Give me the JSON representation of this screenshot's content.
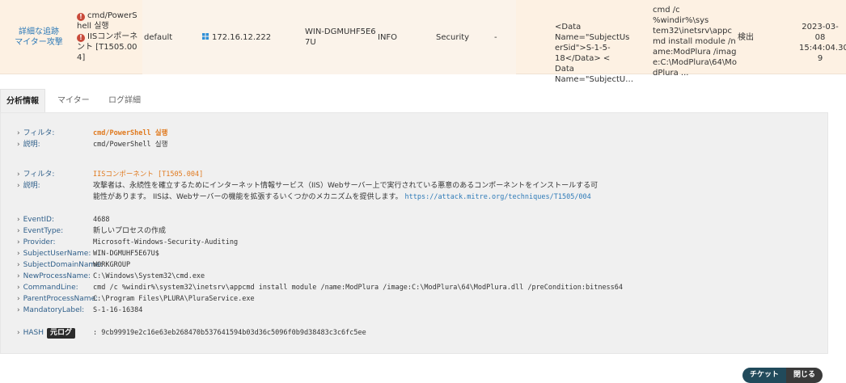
{
  "row": {
    "title_line1": "詳細な追跡",
    "title_line2": "マイター攻撃",
    "rules": [
      {
        "lines": [
          "cmd/PowerS",
          "hell 실행"
        ]
      },
      {
        "lines": [
          "IISコンポーネ",
          "ント [T1505.00",
          "4]"
        ]
      }
    ],
    "group": "default",
    "ip": "172.16.12.222",
    "host_line1": "WIN-DGMUHF5E6",
    "host_line2": "7U",
    "level": "INFO",
    "category": "Security",
    "dash": "-",
    "raw_lines": [
      "<Data Name=\"SubjectUs",
      "erSid\">S-1-5-18</Data> <",
      "Data Name=\"SubjectU…"
    ],
    "cmd_lines": [
      "cmd /c %windir%\\sys",
      "tem32\\inetsrv\\appc",
      "md install module /n",
      "ame:ModPlura /imag",
      "e:C:\\ModPlura\\64\\Mo",
      "dPlura ..."
    ],
    "status": "検出",
    "date_line1": "2023-03-08",
    "date_line2": "15:44:04.30",
    "date_line3": "9"
  },
  "tabs": [
    "分析情報",
    "マイター",
    "ログ詳細"
  ],
  "details": {
    "filter1_label": "フィルタ:",
    "filter1_value": "cmd/PowerShell 실행",
    "desc1_label": "説明:",
    "desc1_value": "cmd/PowerShell 실행",
    "filter2_label": "フィルタ:",
    "filter2_value": "IISコンポーネント [T1505.004]",
    "desc2_label": "説明:",
    "desc2_line1": "攻撃者は、永続性を確立するためにインターネット情報サービス（IIS）Webサーバー上で実行されている悪意のあるコンポーネントをインストールする可",
    "desc2_line2": "能性があります。 IISは、Webサーバーの機能を拡張するいくつかのメカニズムを提供します。",
    "desc2_url": "https://attack.mitre.org/techniques/T1505/004",
    "fields": [
      {
        "label": "EventID:",
        "value": "4688"
      },
      {
        "label": "EventType:",
        "value": "新しいプロセスの作成"
      },
      {
        "label": "Provider:",
        "value": "Microsoft-Windows-Security-Auditing"
      },
      {
        "label": "SubjectUserName:",
        "value": "WIN-DGMUHF5E67U$"
      },
      {
        "label": "SubjectDomainName:",
        "value": "WORKGROUP"
      },
      {
        "label": "NewProcessName:",
        "value": "C:\\Windows\\System32\\cmd.exe"
      },
      {
        "label": "CommandLine:",
        "value": "cmd /c %windir%\\system32\\inetsrv\\appcmd install module /name:ModPlura /image:C:\\ModPlura\\64\\ModPlura.dll /preCondition:bitness64"
      },
      {
        "label": "ParentProcessName:",
        "value": "C:\\Program Files\\PLURA\\PluraService.exe"
      },
      {
        "label": "MandatoryLabel:",
        "value": "S-1-16-16384"
      }
    ],
    "hash_label": "HASH",
    "hash_badge": "元ログ",
    "hash_value": ": 9cb99919e2c16e63eb268470b537641594b03d36c5096f0b9d38483c3c6fc5ee"
  },
  "buttons": {
    "ticket": "チケット",
    "close": "閉じる"
  }
}
